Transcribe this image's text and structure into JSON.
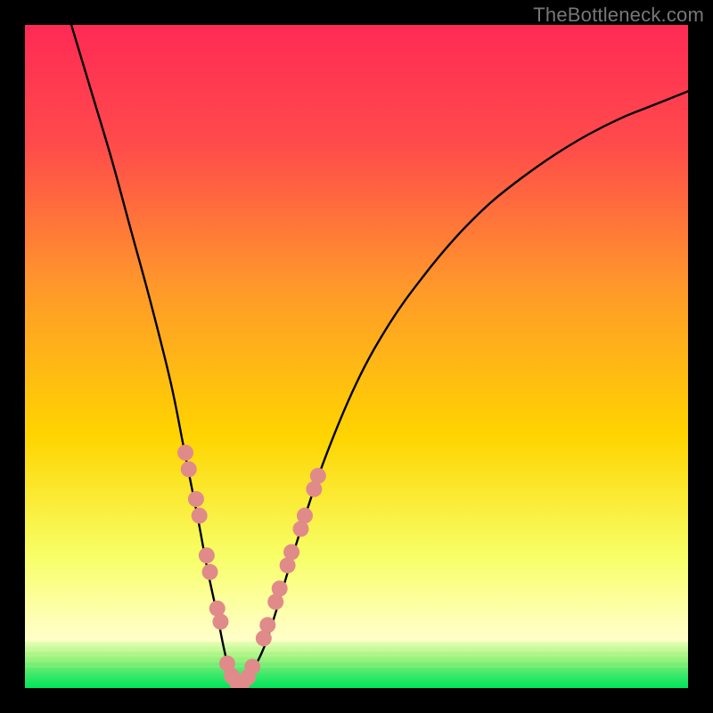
{
  "watermark": "TheBottleneck.com",
  "chart_data": {
    "type": "line",
    "title": "",
    "xlabel": "",
    "ylabel": "",
    "xlim": [
      0,
      100
    ],
    "ylim": [
      0,
      100
    ],
    "grid": false,
    "legend": false,
    "background_gradient": {
      "top": "#ff2a55",
      "mid": "#ffd400",
      "bottom": "#00e65a"
    },
    "green_band_y_range": [
      0,
      7
    ],
    "series": [
      {
        "name": "bottleneck-curve",
        "stroke": "#000000",
        "x": [
          7,
          10,
          13,
          16,
          19,
          22,
          24,
          26,
          27.5,
          29,
          30,
          31,
          32,
          33,
          34,
          36,
          38,
          41,
          45,
          50,
          55,
          60,
          65,
          70,
          75,
          80,
          85,
          90,
          95,
          100
        ],
        "y": [
          100,
          90,
          80,
          69,
          58,
          46,
          36,
          26,
          18,
          11,
          6,
          2,
          0.5,
          0.5,
          2,
          6,
          12,
          22,
          34,
          46,
          55,
          62,
          68,
          73,
          77,
          80.5,
          83.5,
          86,
          88,
          90
        ]
      }
    ],
    "marker_clusters": [
      {
        "name": "left-cluster",
        "color": "#e18a8a",
        "x": [
          24.2,
          24.7,
          25.8,
          26.3,
          27.4,
          27.9,
          29.0,
          29.5
        ],
        "y": [
          35.5,
          33.0,
          28.5,
          26.0,
          20.0,
          17.5,
          12.0,
          10.0
        ]
      },
      {
        "name": "valley-cluster",
        "color": "#e18a8a",
        "x": [
          30.5,
          31.2,
          32.0,
          32.8,
          33.6,
          34.3
        ],
        "y": [
          3.7,
          1.8,
          0.8,
          0.8,
          1.6,
          3.2
        ]
      },
      {
        "name": "right-cluster",
        "color": "#e18a8a",
        "x": [
          36.0,
          36.6,
          37.8,
          38.4,
          39.6,
          40.2,
          41.6,
          42.2,
          43.6,
          44.2
        ],
        "y": [
          7.5,
          9.5,
          13.0,
          15.0,
          18.5,
          20.5,
          24.0,
          26.0,
          30.0,
          32.0
        ]
      }
    ]
  }
}
